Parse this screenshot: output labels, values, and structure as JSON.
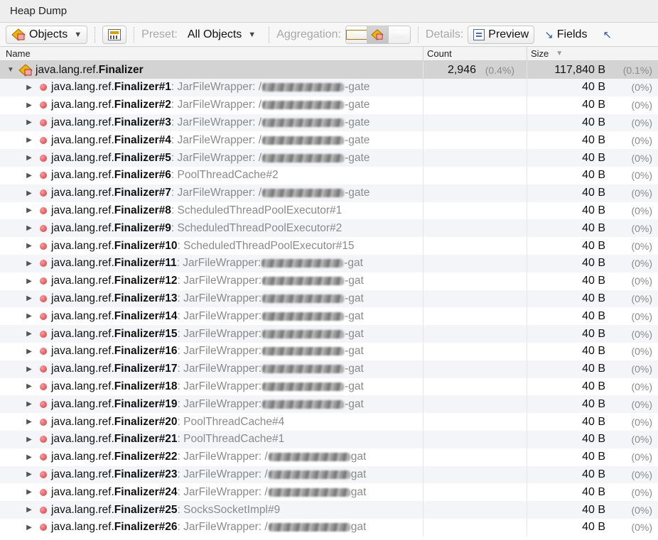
{
  "window": {
    "title": "Heap Dump"
  },
  "toolbar": {
    "objects_label": "Objects",
    "preset_label": "Preset:",
    "preset_value": "All Objects",
    "aggregation_label": "Aggregation:",
    "details_label": "Details:",
    "preview_label": "Preview",
    "fields_label": "Fields"
  },
  "table": {
    "columns": {
      "name": "Name",
      "count": "Count",
      "size": "Size"
    },
    "root": {
      "package": "java.lang.ref.",
      "class": "Finalizer",
      "count": "2,946",
      "count_pct": "(0.4%)",
      "size": "117,840 B",
      "size_pct": "(0.1%)"
    },
    "rows": [
      {
        "instance": "Finalizer#1",
        "detail": " : JarFileWrapper: /",
        "redacted": true,
        "tail": "-gate",
        "size": "40 B",
        "pct": "(0%)"
      },
      {
        "instance": "Finalizer#2",
        "detail": " : JarFileWrapper: /",
        "redacted": true,
        "tail": "-gate",
        "size": "40 B",
        "pct": "(0%)"
      },
      {
        "instance": "Finalizer#3",
        "detail": " : JarFileWrapper: /",
        "redacted": true,
        "tail": "-gate",
        "size": "40 B",
        "pct": "(0%)"
      },
      {
        "instance": "Finalizer#4",
        "detail": " : JarFileWrapper: /",
        "redacted": true,
        "tail": "-gate",
        "size": "40 B",
        "pct": "(0%)"
      },
      {
        "instance": "Finalizer#5",
        "detail": " : JarFileWrapper: /",
        "redacted": true,
        "tail": "-gate",
        "size": "40 B",
        "pct": "(0%)"
      },
      {
        "instance": "Finalizer#6",
        "detail": " : PoolThreadCache#2",
        "redacted": false,
        "tail": "",
        "size": "40 B",
        "pct": "(0%)"
      },
      {
        "instance": "Finalizer#7",
        "detail": " : JarFileWrapper: /",
        "redacted": true,
        "tail": "-gate",
        "size": "40 B",
        "pct": "(0%)"
      },
      {
        "instance": "Finalizer#8",
        "detail": " : ScheduledThreadPoolExecutor#1",
        "redacted": false,
        "tail": "",
        "size": "40 B",
        "pct": "(0%)"
      },
      {
        "instance": "Finalizer#9",
        "detail": " : ScheduledThreadPoolExecutor#2",
        "redacted": false,
        "tail": "",
        "size": "40 B",
        "pct": "(0%)"
      },
      {
        "instance": "Finalizer#10",
        "detail": " : ScheduledThreadPoolExecutor#15",
        "redacted": false,
        "tail": "",
        "size": "40 B",
        "pct": "(0%)"
      },
      {
        "instance": "Finalizer#11",
        "detail": " : JarFileWrapper: ",
        "redacted": true,
        "tail": "-gat",
        "size": "40 B",
        "pct": "(0%)"
      },
      {
        "instance": "Finalizer#12",
        "detail": " : JarFileWrapper: ",
        "redacted": true,
        "tail": "-gat",
        "size": "40 B",
        "pct": "(0%)"
      },
      {
        "instance": "Finalizer#13",
        "detail": " : JarFileWrapper: ",
        "redacted": true,
        "tail": "-gat",
        "size": "40 B",
        "pct": "(0%)"
      },
      {
        "instance": "Finalizer#14",
        "detail": " : JarFileWrapper: ",
        "redacted": true,
        "tail": "-gat",
        "size": "40 B",
        "pct": "(0%)"
      },
      {
        "instance": "Finalizer#15",
        "detail": " : JarFileWrapper: ",
        "redacted": true,
        "tail": "-gat",
        "size": "40 B",
        "pct": "(0%)"
      },
      {
        "instance": "Finalizer#16",
        "detail": " : JarFileWrapper: ",
        "redacted": true,
        "tail": "-gat",
        "size": "40 B",
        "pct": "(0%)"
      },
      {
        "instance": "Finalizer#17",
        "detail": " : JarFileWrapper: ",
        "redacted": true,
        "tail": "-gat",
        "size": "40 B",
        "pct": "(0%)"
      },
      {
        "instance": "Finalizer#18",
        "detail": " : JarFileWrapper: ",
        "redacted": true,
        "tail": "-gat",
        "size": "40 B",
        "pct": "(0%)"
      },
      {
        "instance": "Finalizer#19",
        "detail": " : JarFileWrapper: ",
        "redacted": true,
        "tail": "-gat",
        "size": "40 B",
        "pct": "(0%)"
      },
      {
        "instance": "Finalizer#20",
        "detail": " : PoolThreadCache#4",
        "redacted": false,
        "tail": "",
        "size": "40 B",
        "pct": "(0%)"
      },
      {
        "instance": "Finalizer#21",
        "detail": " : PoolThreadCache#1",
        "redacted": false,
        "tail": "",
        "size": "40 B",
        "pct": "(0%)"
      },
      {
        "instance": "Finalizer#22",
        "detail": " : JarFileWrapper: /",
        "redacted": true,
        "tail": "gat",
        "size": "40 B",
        "pct": "(0%)"
      },
      {
        "instance": "Finalizer#23",
        "detail": " : JarFileWrapper: /",
        "redacted": true,
        "tail": "gat",
        "size": "40 B",
        "pct": "(0%)"
      },
      {
        "instance": "Finalizer#24",
        "detail": " : JarFileWrapper: /",
        "redacted": true,
        "tail": "gat",
        "size": "40 B",
        "pct": "(0%)"
      },
      {
        "instance": "Finalizer#25",
        "detail": " : SocksSocketImpl#9",
        "redacted": false,
        "tail": "",
        "size": "40 B",
        "pct": "(0%)"
      },
      {
        "instance": "Finalizer#26",
        "detail": " : JarFileWrapper: /",
        "redacted": true,
        "tail": "gat",
        "size": "40 B",
        "pct": "(0%)"
      }
    ],
    "child_package": "java.lang.ref."
  }
}
